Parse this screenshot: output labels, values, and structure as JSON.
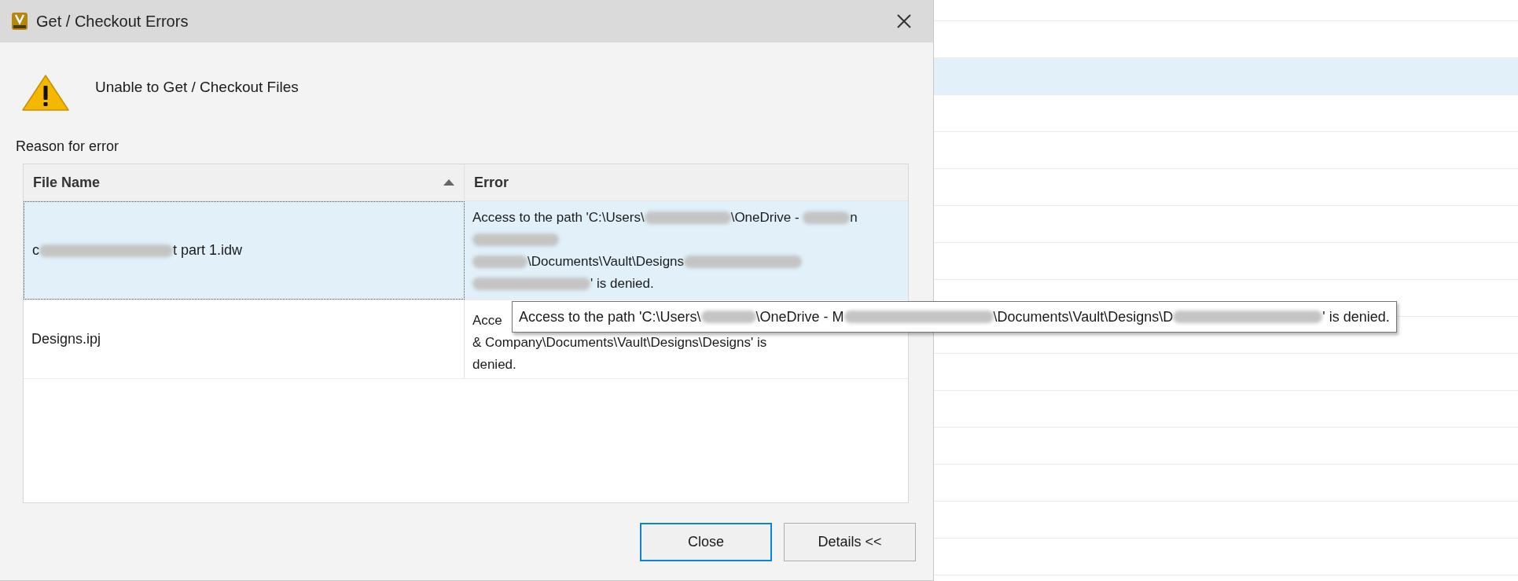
{
  "dialog": {
    "title": "Get / Checkout Errors",
    "message": "Unable to Get / Checkout Files",
    "section_label": "Reason for error",
    "table": {
      "columns": [
        {
          "label": "File Name",
          "sorted": true
        },
        {
          "label": "Error",
          "sorted": false
        }
      ],
      "rows": [
        {
          "selected": true,
          "file": [
            {
              "kind": "text",
              "text": "c"
            },
            {
              "kind": "redacted"
            },
            {
              "kind": "text",
              "text": "t part 1.idw"
            }
          ],
          "error_lines": [
            [
              {
                "kind": "text",
                "text": "Access to the path 'C:\\Users\\"
              },
              {
                "kind": "redacted"
              },
              {
                "kind": "text",
                "text": "\\OneDrive - "
              },
              {
                "kind": "redacted"
              },
              {
                "kind": "text",
                "text": "n"
              }
            ],
            [
              {
                "kind": "redacted"
              }
            ],
            [
              {
                "kind": "redacted"
              },
              {
                "kind": "text",
                "text": "\\Documents\\Vault\\Designs"
              },
              {
                "kind": "redacted"
              }
            ],
            [
              {
                "kind": "redacted"
              },
              {
                "kind": "text",
                "text": "' is denied."
              }
            ]
          ]
        },
        {
          "selected": false,
          "file": [
            {
              "kind": "text",
              "text": "Designs.ipj"
            }
          ],
          "error_lines": [
            [
              {
                "kind": "text",
                "text": "Acce"
              }
            ],
            [
              {
                "kind": "text",
                "text": "& Company\\Documents\\Vault\\Designs\\Designs' is"
              }
            ],
            [
              {
                "kind": "text",
                "text": "denied."
              }
            ]
          ]
        }
      ]
    },
    "buttons": [
      {
        "label": "Close",
        "default": true
      },
      {
        "label": "Details <<",
        "default": false
      }
    ]
  },
  "tooltip": [
    {
      "kind": "text",
      "text": "Access to the path 'C:\\Users\\"
    },
    {
      "kind": "redacted"
    },
    {
      "kind": "text",
      "text": "\\OneDrive - M"
    },
    {
      "kind": "redacted"
    },
    {
      "kind": "text",
      "text": "\\Documents\\Vault\\Designs\\D"
    },
    {
      "kind": "redacted"
    },
    {
      "kind": "text",
      "text": "' is denied."
    }
  ],
  "background_list": {
    "rows": [
      {
        "selected": false
      },
      {
        "selected": false
      },
      {
        "selected": true
      },
      {
        "selected": false
      },
      {
        "selected": false
      },
      {
        "selected": false
      },
      {
        "selected": false
      },
      {
        "selected": false
      },
      {
        "selected": false
      },
      {
        "selected": false
      },
      {
        "selected": false
      },
      {
        "selected": false
      },
      {
        "selected": false
      },
      {
        "selected": false
      },
      {
        "selected": false
      },
      {
        "selected": false
      }
    ]
  }
}
